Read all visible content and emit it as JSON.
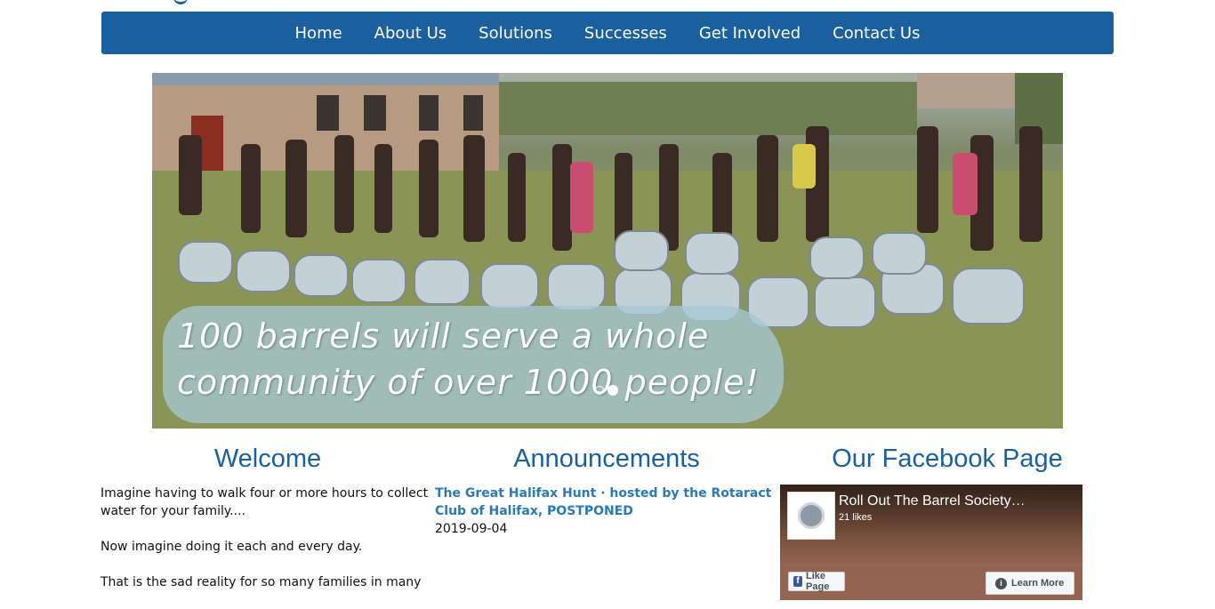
{
  "nav": {
    "items": [
      {
        "label": "Home"
      },
      {
        "label": "About Us"
      },
      {
        "label": "Solutions"
      },
      {
        "label": "Successes"
      },
      {
        "label": "Get Involved"
      },
      {
        "label": "Contact Us"
      }
    ]
  },
  "slider": {
    "caption_line1": "100 barrels will serve a whole",
    "caption_line2": "community of over 1000 people!",
    "slide_count": 2,
    "active_slide": 2
  },
  "welcome": {
    "title": "Welcome",
    "paragraphs": [
      "Imagine having to walk four or more hours to collect water for your family....",
      "Now imagine doing it each and every day.",
      "That is the sad reality for so many families in many"
    ]
  },
  "announcements": {
    "title": "Announcements",
    "items": [
      {
        "title": "The Great Halifax Hunt · hosted by the Rotaract Club of Halifax, POSTPONED",
        "date": "2019-09-04"
      }
    ]
  },
  "facebook": {
    "title": "Our Facebook Page",
    "page_name": "Roll Out The Barrel Society…",
    "likes": "21 likes",
    "like_button": "Like Page",
    "learn_button": "Learn More"
  },
  "colors": {
    "brand_blue": "#1a5f9e",
    "link_blue": "#2a7ab8"
  }
}
